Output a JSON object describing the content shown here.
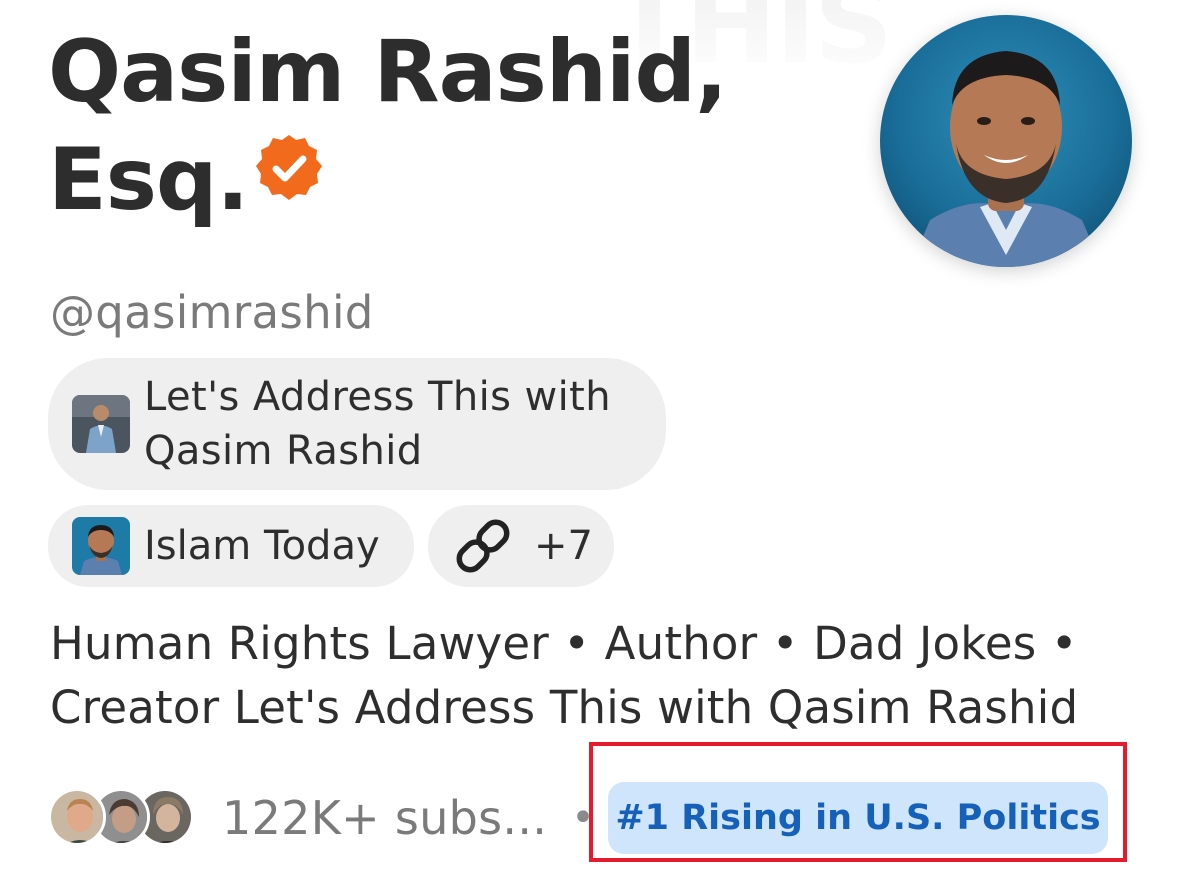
{
  "profile": {
    "name": "Qasim Rashid, Esq.",
    "handle": "@qasimrashid",
    "verified_badge_icon": "verified-check-icon",
    "badge_color": "#f26a1b"
  },
  "publications": [
    {
      "name": "Let's Address This with Qasim Rashid"
    },
    {
      "name": "Islam Today"
    }
  ],
  "links": {
    "icon": "link-icon",
    "count_label": "+7"
  },
  "bio": "Human Rights Lawyer • Author • Dad Jokes • Creator Let's Address This with Qasim Rashid",
  "subscribers": {
    "label": "122K+ subs...",
    "separator": "•"
  },
  "rank_badge": {
    "label": "#1 Rising in U.S. Politics",
    "bg_color": "#cfe5fb",
    "text_color": "#1560b8"
  },
  "highlight_color": "#e41b2c"
}
